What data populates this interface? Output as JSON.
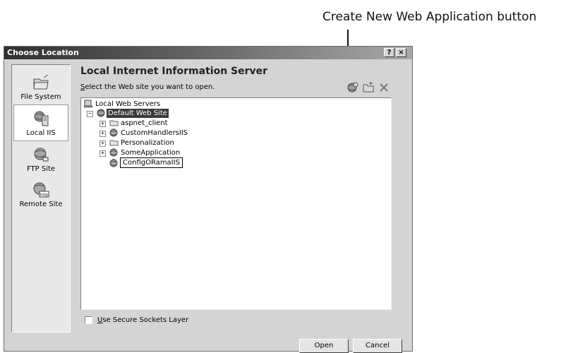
{
  "callout": {
    "text": "Create New Web Application button"
  },
  "window": {
    "title": "Choose Location",
    "help_label": "?",
    "close_label": "×"
  },
  "sidebar": {
    "items": [
      {
        "label": "File System",
        "icon": "file-system-icon",
        "selected": false
      },
      {
        "label": "Local IIS",
        "icon": "local-iis-icon",
        "selected": true
      },
      {
        "label": "FTP Site",
        "icon": "ftp-site-icon",
        "selected": false
      },
      {
        "label": "Remote Site",
        "icon": "remote-site-icon",
        "selected": false
      }
    ]
  },
  "main": {
    "heading": "Local Internet Information Server",
    "instruction_hotkey": "S",
    "instruction_rest": "elect the Web site you want to open.",
    "toolbar": [
      "create-web-application-icon",
      "create-virtual-directory-icon",
      "delete-icon"
    ]
  },
  "tree": {
    "root": "Local Web Servers",
    "site": "Default Web Site",
    "children": [
      "aspnet_client",
      "CustomHandlersIIS",
      "Personalization",
      "SomeApplication"
    ],
    "new_app_name": "ConfigORamaIIS"
  },
  "options": {
    "ssl_hotkey": "U",
    "ssl_rest": "se Secure Sockets Layer",
    "ssl_checked": false
  },
  "buttons": {
    "open": "Open",
    "cancel": "Cancel"
  }
}
